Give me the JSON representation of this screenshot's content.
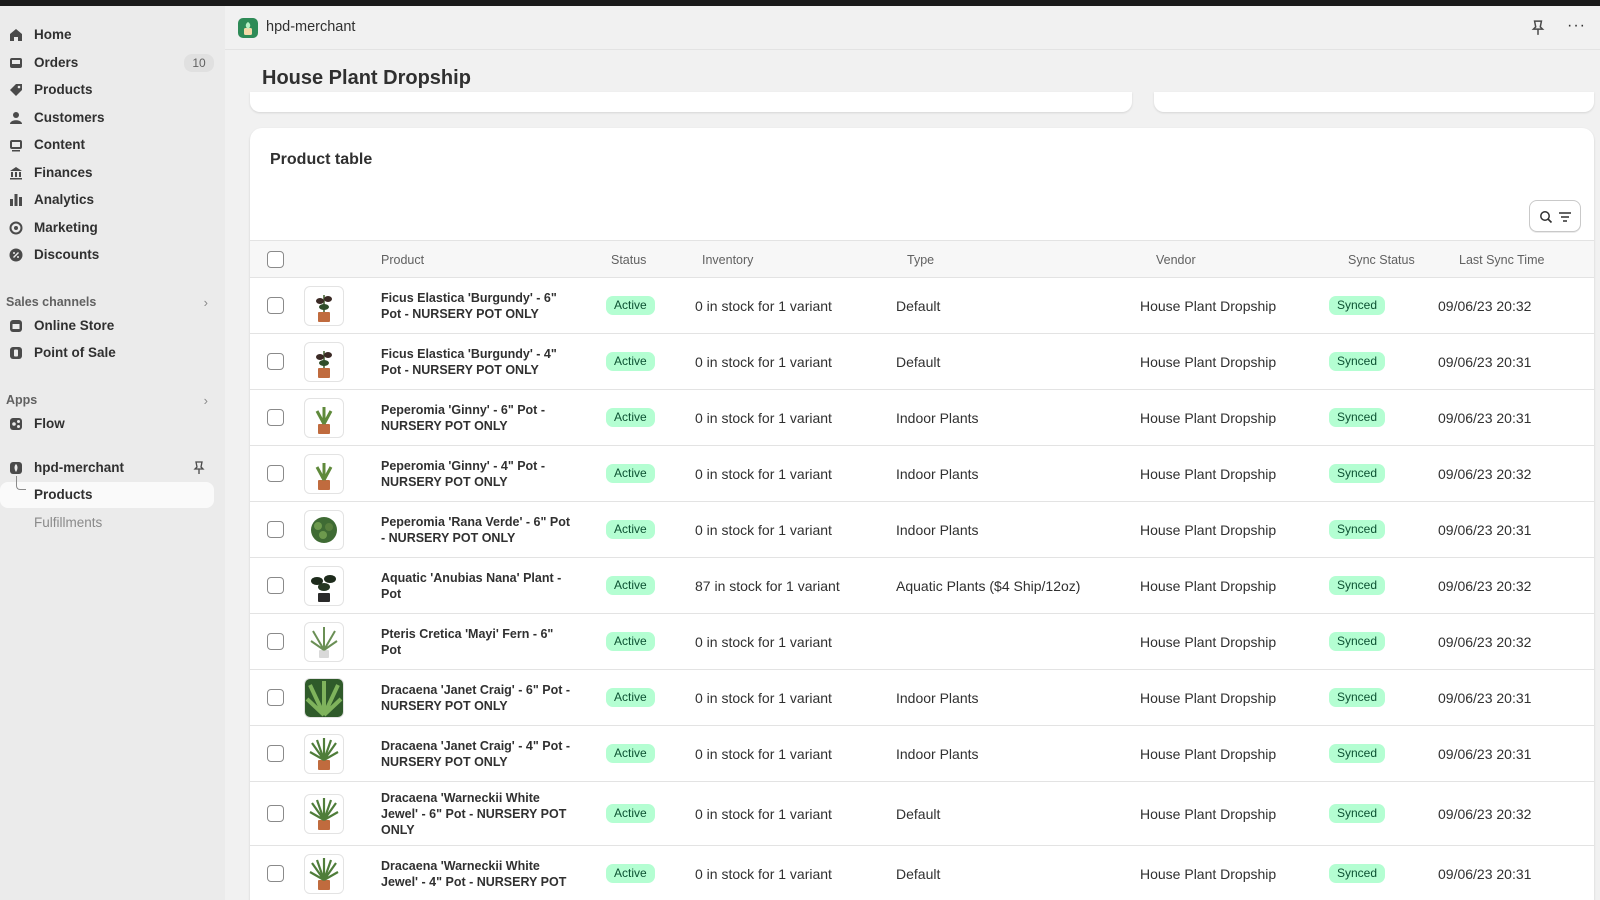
{
  "sidebar": {
    "items": [
      {
        "label": "Home",
        "icon": "home-icon"
      },
      {
        "label": "Orders",
        "icon": "inbox-icon",
        "badge": "10"
      },
      {
        "label": "Products",
        "icon": "tag-icon"
      },
      {
        "label": "Customers",
        "icon": "person-icon"
      },
      {
        "label": "Content",
        "icon": "image-icon"
      },
      {
        "label": "Finances",
        "icon": "bank-icon"
      },
      {
        "label": "Analytics",
        "icon": "bar-chart-icon"
      },
      {
        "label": "Marketing",
        "icon": "target-icon"
      },
      {
        "label": "Discounts",
        "icon": "discount-icon"
      }
    ],
    "sales_channels": {
      "heading": "Sales channels",
      "items": [
        {
          "label": "Online Store",
          "icon": "store-icon"
        },
        {
          "label": "Point of Sale",
          "icon": "pos-icon"
        }
      ]
    },
    "apps": {
      "heading": "Apps",
      "items": [
        {
          "label": "Flow",
          "icon": "flow-icon"
        }
      ]
    },
    "pinned_app": {
      "label": "hpd-merchant",
      "sub_items": [
        {
          "label": "Products",
          "selected": true
        },
        {
          "label": "Fulfillments",
          "selected": false
        }
      ]
    }
  },
  "header": {
    "app_name": "hpd-merchant",
    "page_title": "House Plant Dropship"
  },
  "product_table": {
    "title": "Product table",
    "columns": [
      "Product",
      "Status",
      "Inventory",
      "Type",
      "Vendor",
      "Sync Status",
      "Last Sync Time"
    ],
    "rows": [
      {
        "product_line1": "Ficus Elastica 'Burgundy' - 6\"",
        "product_line2": "Pot - NURSERY POT ONLY",
        "status": "Active",
        "inventory": "0 in stock for 1 variant",
        "type": "Default",
        "vendor": "House Plant Dropship",
        "sync_status": "Synced",
        "last_sync": "09/06/23 20:32",
        "thumb": "ficus"
      },
      {
        "product_line1": "Ficus Elastica 'Burgundy' - 4\"",
        "product_line2": "Pot - NURSERY POT ONLY",
        "status": "Active",
        "inventory": "0 in stock for 1 variant",
        "type": "Default",
        "vendor": "House Plant Dropship",
        "sync_status": "Synced",
        "last_sync": "09/06/23 20:31",
        "thumb": "ficus"
      },
      {
        "product_line1": "Peperomia 'Ginny' - 6\" Pot -",
        "product_line2": "NURSERY POT ONLY",
        "status": "Active",
        "inventory": "0 in stock for 1 variant",
        "type": "Indoor Plants",
        "vendor": "House Plant Dropship",
        "sync_status": "Synced",
        "last_sync": "09/06/23 20:31",
        "thumb": "small"
      },
      {
        "product_line1": "Peperomia 'Ginny' - 4\" Pot -",
        "product_line2": "NURSERY POT ONLY",
        "status": "Active",
        "inventory": "0 in stock for 1 variant",
        "type": "Indoor Plants",
        "vendor": "House Plant Dropship",
        "sync_status": "Synced",
        "last_sync": "09/06/23 20:32",
        "thumb": "small"
      },
      {
        "product_line1": "Peperomia 'Rana Verde' - 6\" Pot",
        "product_line2": "- NURSERY POT ONLY",
        "status": "Active",
        "inventory": "0 in stock for 1 variant",
        "type": "Indoor Plants",
        "vendor": "House Plant Dropship",
        "sync_status": "Synced",
        "last_sync": "09/06/23 20:31",
        "thumb": "bushy"
      },
      {
        "product_line1": "Aquatic 'Anubias Nana' Plant -",
        "product_line2": "Pot",
        "status": "Active",
        "inventory": "87 in stock for 1 variant",
        "type": "Aquatic Plants ($4 Ship/12oz)",
        "vendor": "House Plant Dropship",
        "sync_status": "Synced",
        "last_sync": "09/06/23 20:32",
        "thumb": "dark"
      },
      {
        "product_line1": "Pteris Cretica 'Mayi' Fern - 6\"",
        "product_line2": "Pot",
        "status": "Active",
        "inventory": "0 in stock for 1 variant",
        "type": "",
        "vendor": "House Plant Dropship",
        "sync_status": "Synced",
        "last_sync": "09/06/23 20:32",
        "thumb": "fern"
      },
      {
        "product_line1": "Dracaena 'Janet Craig' - 6\" Pot -",
        "product_line2": "NURSERY POT ONLY",
        "status": "Active",
        "inventory": "0 in stock for 1 variant",
        "type": "Indoor Plants",
        "vendor": "House Plant Dropship",
        "sync_status": "Synced",
        "last_sync": "09/06/23 20:31",
        "thumb": "leafy"
      },
      {
        "product_line1": "Dracaena 'Janet Craig' - 4\" Pot -",
        "product_line2": "NURSERY POT ONLY",
        "status": "Active",
        "inventory": "0 in stock for 1 variant",
        "type": "Indoor Plants",
        "vendor": "House Plant Dropship",
        "sync_status": "Synced",
        "last_sync": "09/06/23 20:31",
        "thumb": "spiky"
      },
      {
        "product_line1": "Dracaena 'Warneckii White",
        "product_line2": "Jewel' - 6\" Pot - NURSERY POT",
        "product_line3": "ONLY",
        "status": "Active",
        "inventory": "0 in stock for 1 variant",
        "type": "Default",
        "vendor": "House Plant Dropship",
        "sync_status": "Synced",
        "last_sync": "09/06/23 20:32",
        "thumb": "spiky"
      },
      {
        "product_line1": "Dracaena 'Warneckii White",
        "product_line2": "Jewel' - 4\" Pot - NURSERY POT",
        "status": "Active",
        "inventory": "0 in stock for 1 variant",
        "type": "Default",
        "vendor": "House Plant Dropship",
        "sync_status": "Synced",
        "last_sync": "09/06/23 20:31",
        "thumb": "spiky"
      }
    ]
  }
}
